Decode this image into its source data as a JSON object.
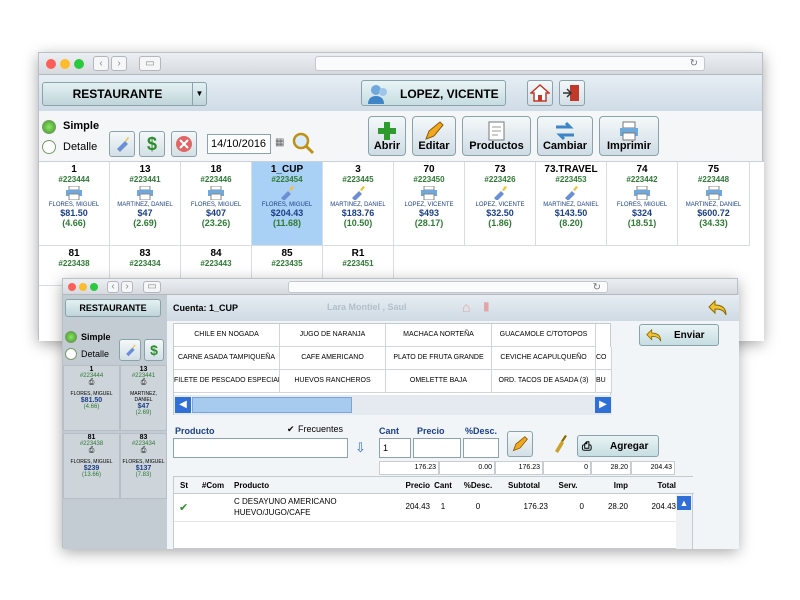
{
  "main_window": {
    "section_select": "RESTAURANTE",
    "user_name": "LOPEZ, VICENTE",
    "view_simple": "Simple",
    "view_detail": "Detalle",
    "date": "14/10/2016",
    "actions": [
      {
        "label": "Abrir"
      },
      {
        "label": "Editar"
      },
      {
        "label": "Productos"
      },
      {
        "label": "Cambiar"
      },
      {
        "label": "Imprimir"
      }
    ],
    "tables": [
      {
        "name": "1",
        "id": "#223444",
        "waiter": "FLORES, MIGUEL",
        "amount": "$81.50",
        "sub": "(4.66)",
        "icon": "printer",
        "selected": false
      },
      {
        "name": "13",
        "id": "#223441",
        "waiter": "MARTINEZ, DANIEL",
        "amount": "$47",
        "sub": "(2.69)",
        "icon": "printer",
        "selected": false
      },
      {
        "name": "18",
        "id": "#223446",
        "waiter": "FLORES, MIGUEL",
        "amount": "$407",
        "sub": "(23.26)",
        "icon": "printer",
        "selected": false
      },
      {
        "name": "1_CUP",
        "id": "#223454",
        "waiter": "FLORES, MIGUEL",
        "amount": "$204.43",
        "sub": "(11.68)",
        "icon": "broom",
        "selected": true
      },
      {
        "name": "3",
        "id": "#223445",
        "waiter": "MARTINEZ, DANIEL",
        "amount": "$183.76",
        "sub": "(10.50)",
        "icon": "broom",
        "selected": false
      },
      {
        "name": "70",
        "id": "#223450",
        "waiter": "LOPEZ, VICENTE",
        "amount": "$493",
        "sub": "(28.17)",
        "icon": "printer",
        "selected": false
      },
      {
        "name": "73",
        "id": "#223426",
        "waiter": "LOPEZ, VICENTE",
        "amount": "$32.50",
        "sub": "(1.86)",
        "icon": "broom",
        "selected": false
      },
      {
        "name": "73.TRAVEL",
        "id": "#223453",
        "waiter": "MARTINEZ, DANIEL",
        "amount": "$143.50",
        "sub": "(8.20)",
        "icon": "broom",
        "selected": false
      },
      {
        "name": "74",
        "id": "#223442",
        "waiter": "FLORES, MIGUEL",
        "amount": "$324",
        "sub": "(18.51)",
        "icon": "printer",
        "selected": false
      },
      {
        "name": "75",
        "id": "#223448",
        "waiter": "MARTINEZ, DANIEL",
        "amount": "$600.72",
        "sub": "(34.33)",
        "icon": "printer",
        "selected": false
      }
    ],
    "tables_row2": [
      {
        "name": "81",
        "id": "#223438"
      },
      {
        "name": "83",
        "id": "#223434"
      },
      {
        "name": "84",
        "id": "#223443"
      },
      {
        "name": "85",
        "id": "#223435"
      },
      {
        "name": "R1",
        "id": "#223451"
      }
    ]
  },
  "front_window": {
    "section_select": "RESTAURANTE",
    "account_label": "Cuenta: 1_CUP",
    "user_name": "Lara Montiel , Saul",
    "send_button": "Enviar",
    "view_simple": "Simple",
    "view_detail": "Detalle",
    "side_tables": [
      {
        "name": "1",
        "id": "#223444",
        "waiter": "FLORES, MIGUEL",
        "amount": "$81.50",
        "sub": "(4.66)"
      },
      {
        "name": "13",
        "id": "#223441",
        "waiter": "MARTINEZ, DANIEL",
        "amount": "$47",
        "sub": "(2.69)"
      },
      {
        "name": "81",
        "id": "#223438",
        "waiter": "FLORES, MIGUEL",
        "amount": "$239",
        "sub": "(13.66)"
      },
      {
        "name": "83",
        "id": "#223434",
        "waiter": "FLORES, MIGUEL",
        "amount": "$137",
        "sub": "(7.83)"
      }
    ],
    "products": [
      [
        "CHILE EN NOGADA",
        "JUGO DE NARANJA",
        "MACHACA NORTEÑA",
        "GUACAMOLE C/TOTOPOS",
        ""
      ],
      [
        "CARNE ASADA TAMPIQUEÑA",
        "CAFE AMERICANO",
        "PLATO DE FRUTA GRANDE",
        "CEVICHE ACAPULQUEÑO",
        "CO"
      ],
      [
        "FILETE DE PESCADO ESPECIAL",
        "HUEVOS RANCHEROS",
        "OMELETTE BAJA",
        "ORD. TACOS DE ASADA (3)",
        "BU"
      ]
    ],
    "form": {
      "product_label": "Producto",
      "frequent_label": "Frecuentes",
      "qty_label": "Cant",
      "price_label": "Precio",
      "disc_label": "%Desc.",
      "qty_value": "1",
      "add_button": "Agregar"
    },
    "totals": [
      "176.23",
      "0.00",
      "176.23",
      "0",
      "28.20",
      "204.43"
    ],
    "columns": [
      "St",
      "#Com",
      "Producto",
      "Precio",
      "Cant",
      "%Desc.",
      "Subtotal",
      "Serv.",
      "Imp",
      "Total"
    ],
    "rows": [
      {
        "st": "✔",
        "com": "",
        "product_line1": "C DESAYUNO AMERICANO",
        "product_line2": "HUEVO/JUGO/CAFE",
        "price": "204.43",
        "qty": "1",
        "disc": "0",
        "subtotal": "176.23",
        "serv": "0",
        "imp": "28.20",
        "total": "204.43"
      }
    ]
  }
}
